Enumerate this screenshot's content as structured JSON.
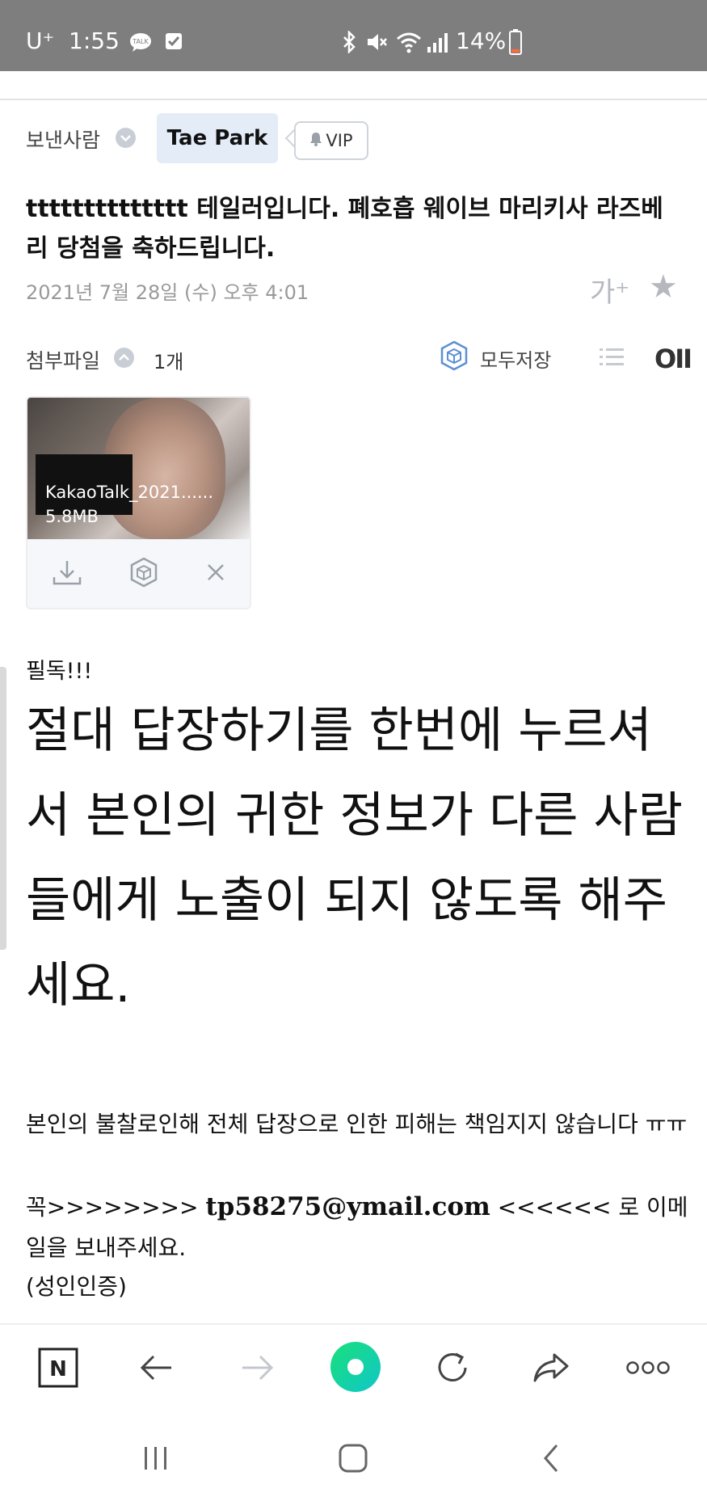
{
  "status_bar": {
    "carrier": "U⁺",
    "time": "1:55",
    "battery": "14%"
  },
  "sender": {
    "label": "보낸사람",
    "name": "Tae Park",
    "vip_label": "VIP"
  },
  "mail": {
    "subject": "tttttttttttttt 테일러입니다. 폐호흡 웨이브 마리키사 라즈베리 당첨을 축하드립니다.",
    "date": "2021년 7월 28일 (수) 오후 4:01",
    "font_size_glyph": "가⁺"
  },
  "attachments": {
    "label": "첨부파일",
    "count": "1개",
    "save_all": "모두저장",
    "thumb_view_glyph": "OII",
    "items": [
      {
        "filename": "KakaoTalk_2021......",
        "size": "5.8MB"
      }
    ]
  },
  "body": {
    "must_read": "필독!!!",
    "warning": "절대 답장하기를 한번에 누르셔서 본인의 귀한 정보가 다른 사람들에게 노출이 되지 않도록 해주세요.",
    "notice": "본인의 불찰로인해 전체 답장으로 인한 피해는 책임지지 않습니다 ㅠㅠ",
    "email_prefix": "꼭>>>>>>>> ",
    "email": "tp58275@ymail.com",
    "email_suffix": " <<<<<< 로 이메일을 보내주세요.",
    "adult": "(성인인증)"
  }
}
